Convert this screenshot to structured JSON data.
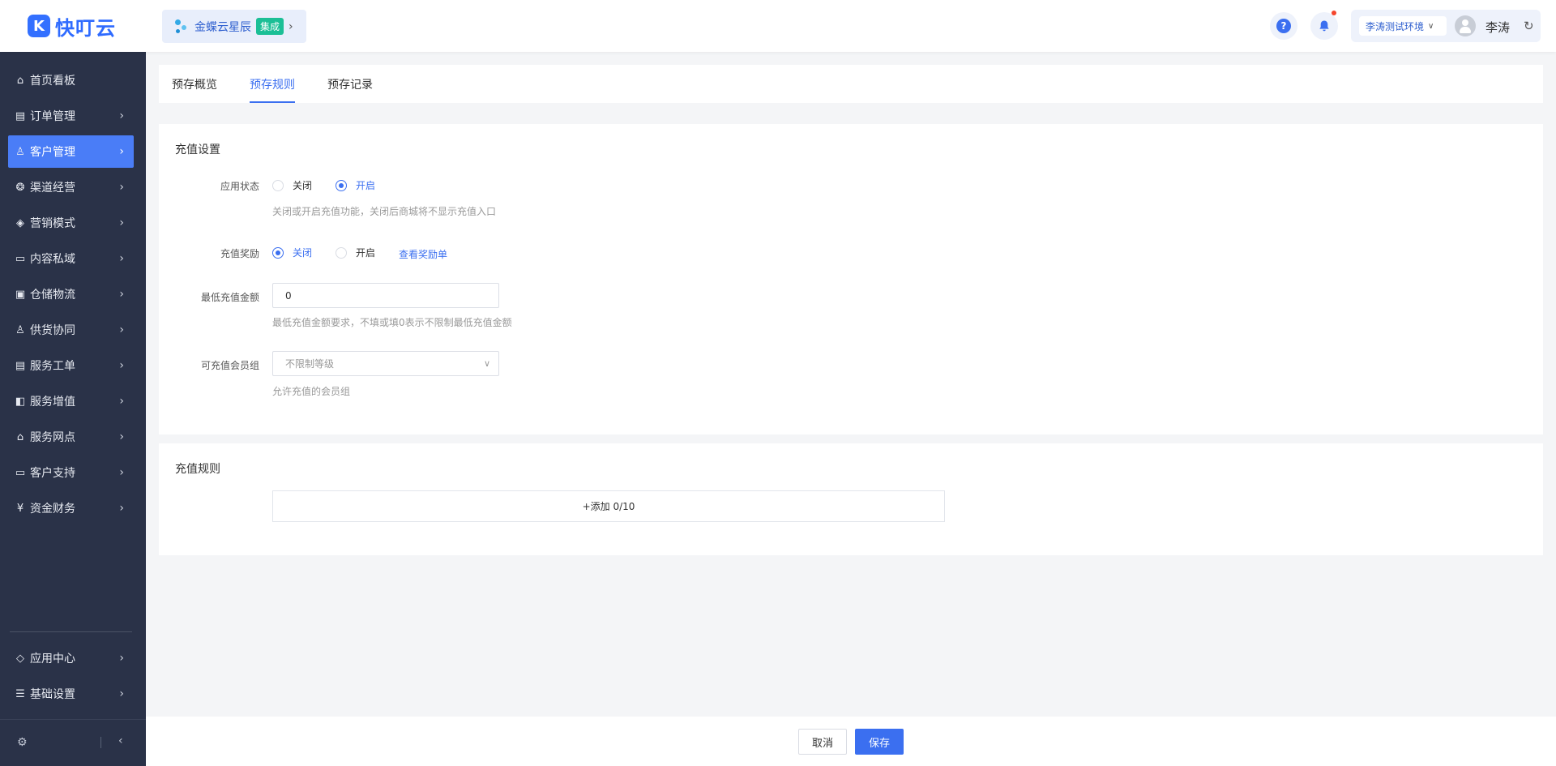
{
  "header": {
    "logo_text": "快叮云",
    "logo_mark": "K",
    "brand_name": "金蝶云星辰",
    "brand_badge": "集成",
    "env_label": "李涛测试环境",
    "user_name": "李涛",
    "icons": [
      "help-icon",
      "bell-icon",
      "chevron-down-icon",
      "avatar",
      "refresh-icon"
    ],
    "notification_dot_color": "#f5462d"
  },
  "sidebar": {
    "items": [
      {
        "label": "首页看板",
        "icon": "home-icon",
        "has_arrow": false
      },
      {
        "label": "订单管理",
        "icon": "clipboard-icon",
        "has_arrow": true
      },
      {
        "label": "客户管理",
        "icon": "user-icon",
        "has_arrow": true,
        "active": true
      },
      {
        "label": "渠道经营",
        "icon": "channel-icon",
        "has_arrow": true
      },
      {
        "label": "营销模式",
        "icon": "tag-icon",
        "has_arrow": true
      },
      {
        "label": "内容私域",
        "icon": "image-icon",
        "has_arrow": true
      },
      {
        "label": "仓储物流",
        "icon": "box-icon",
        "has_arrow": true
      },
      {
        "label": "供货协同",
        "icon": "supplier-icon",
        "has_arrow": true
      },
      {
        "label": "服务工单",
        "icon": "ticket-icon",
        "has_arrow": true
      },
      {
        "label": "服务增值",
        "icon": "bag-icon",
        "has_arrow": true
      },
      {
        "label": "服务网点",
        "icon": "store-icon",
        "has_arrow": true
      },
      {
        "label": "客户支持",
        "icon": "support-icon",
        "has_arrow": true
      },
      {
        "label": "资金财务",
        "icon": "yuan-icon",
        "has_arrow": true
      }
    ],
    "bottom_items": [
      {
        "label": "应用中心",
        "icon": "cube-icon",
        "has_arrow": true
      },
      {
        "label": "基础设置",
        "icon": "settings-list-icon",
        "has_arrow": true
      }
    ],
    "active_color": "#4a7df7"
  },
  "tabs": [
    {
      "label": "预存概览",
      "active": false
    },
    {
      "label": "预存规则",
      "active": true
    },
    {
      "label": "预存记录",
      "active": false
    }
  ],
  "recharge_settings": {
    "title": "充值设置",
    "app_status": {
      "label": "应用状态",
      "options": [
        "关闭",
        "开启"
      ],
      "selected": "开启",
      "hint": "关闭或开启充值功能，关闭后商城将不显示充值入口"
    },
    "reward": {
      "label": "充值奖励",
      "options": [
        "关闭",
        "开启"
      ],
      "selected": "关闭",
      "link": "查看奖励单"
    },
    "min_amount": {
      "label": "最低充值金额",
      "value": "0",
      "hint": "最低充值金额要求，不填或填0表示不限制最低充值金额"
    },
    "member_group": {
      "label": "可充值会员组",
      "placeholder": "不限制等级",
      "hint": "允许充值的会员组"
    }
  },
  "recharge_rules": {
    "title": "充值规则",
    "add_label": "+添加 0/10"
  },
  "footer": {
    "cancel_label": "取消",
    "save_label": "保存"
  },
  "colors": {
    "primary": "#3b6ff0",
    "sidebar_bg": "#2a3248",
    "page_bg": "#f4f5f7"
  }
}
